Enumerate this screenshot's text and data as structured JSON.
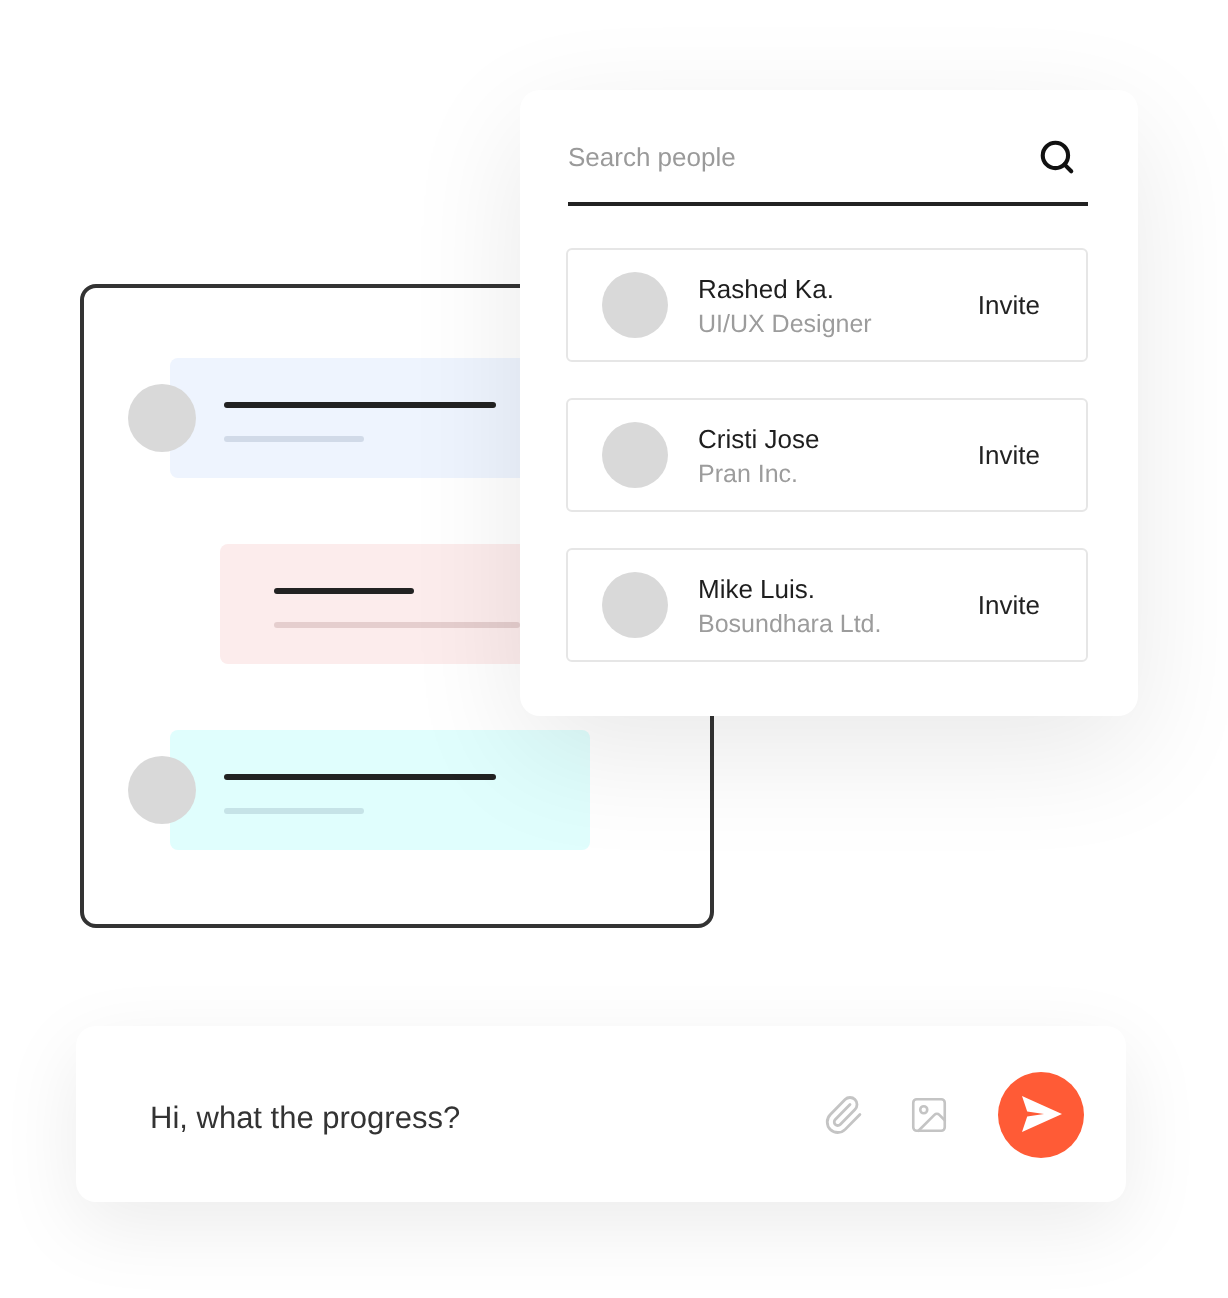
{
  "chat_preview": {
    "bubbles": [
      {
        "kind": "incoming",
        "color": "#eef4fe"
      },
      {
        "kind": "outgoing",
        "color": "#fcecec"
      },
      {
        "kind": "incoming",
        "color": "#e0fefd"
      }
    ]
  },
  "search_panel": {
    "search": {
      "placeholder": "Search people"
    },
    "people": [
      {
        "name": "Rashed Ka.",
        "subtitle": "UI/UX Designer",
        "action": "Invite"
      },
      {
        "name": "Cristi Jose",
        "subtitle": "Pran Inc.",
        "action": "Invite"
      },
      {
        "name": "Mike Luis.",
        "subtitle": "Bosundhara Ltd.",
        "action": "Invite"
      }
    ]
  },
  "composer": {
    "message": {
      "value": "Hi, what the progress?"
    }
  }
}
